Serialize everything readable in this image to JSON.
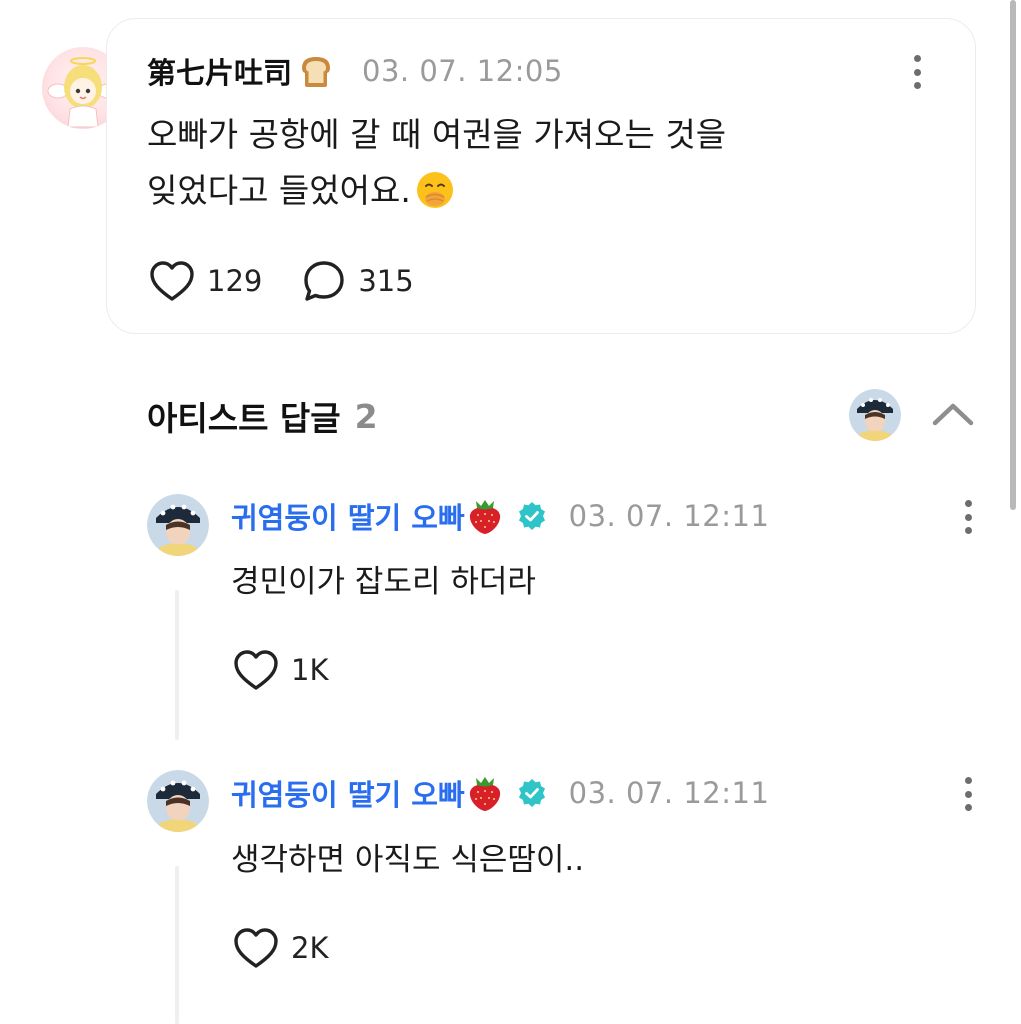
{
  "post": {
    "author": "第七片吐司",
    "author_emoji": "bread-emoji",
    "timestamp": "03. 07. 12:05",
    "body_line1": "오빠가 공항에 갈 때 여권을 가져오는 것을",
    "body_line2": "잊었다고 들었어요.",
    "body_emoji": "face-with-hand-over-mouth-emoji",
    "likes": "129",
    "comments": "315"
  },
  "artist_replies": {
    "title": "아티스트 답글",
    "count": "2",
    "replies": [
      {
        "author": "귀염둥이 딸기 오빠",
        "author_emoji": "strawberry-emoji",
        "verified": true,
        "timestamp": "03. 07. 12:11",
        "body": "경민이가 잡도리 하더라",
        "likes": "1K"
      },
      {
        "author": "귀염둥이 딸기 오빠",
        "author_emoji": "strawberry-emoji",
        "verified": true,
        "timestamp": "03. 07. 12:11",
        "body": "생각하면 아직도 식은땀이..",
        "likes": "2K"
      }
    ]
  },
  "colors": {
    "artist_name": "#2a6ef0",
    "verified_badge": "#2ec4c8",
    "timestamp": "#9a9a9a",
    "card_border": "#ececec",
    "reply_count": "#8b8b8b"
  }
}
